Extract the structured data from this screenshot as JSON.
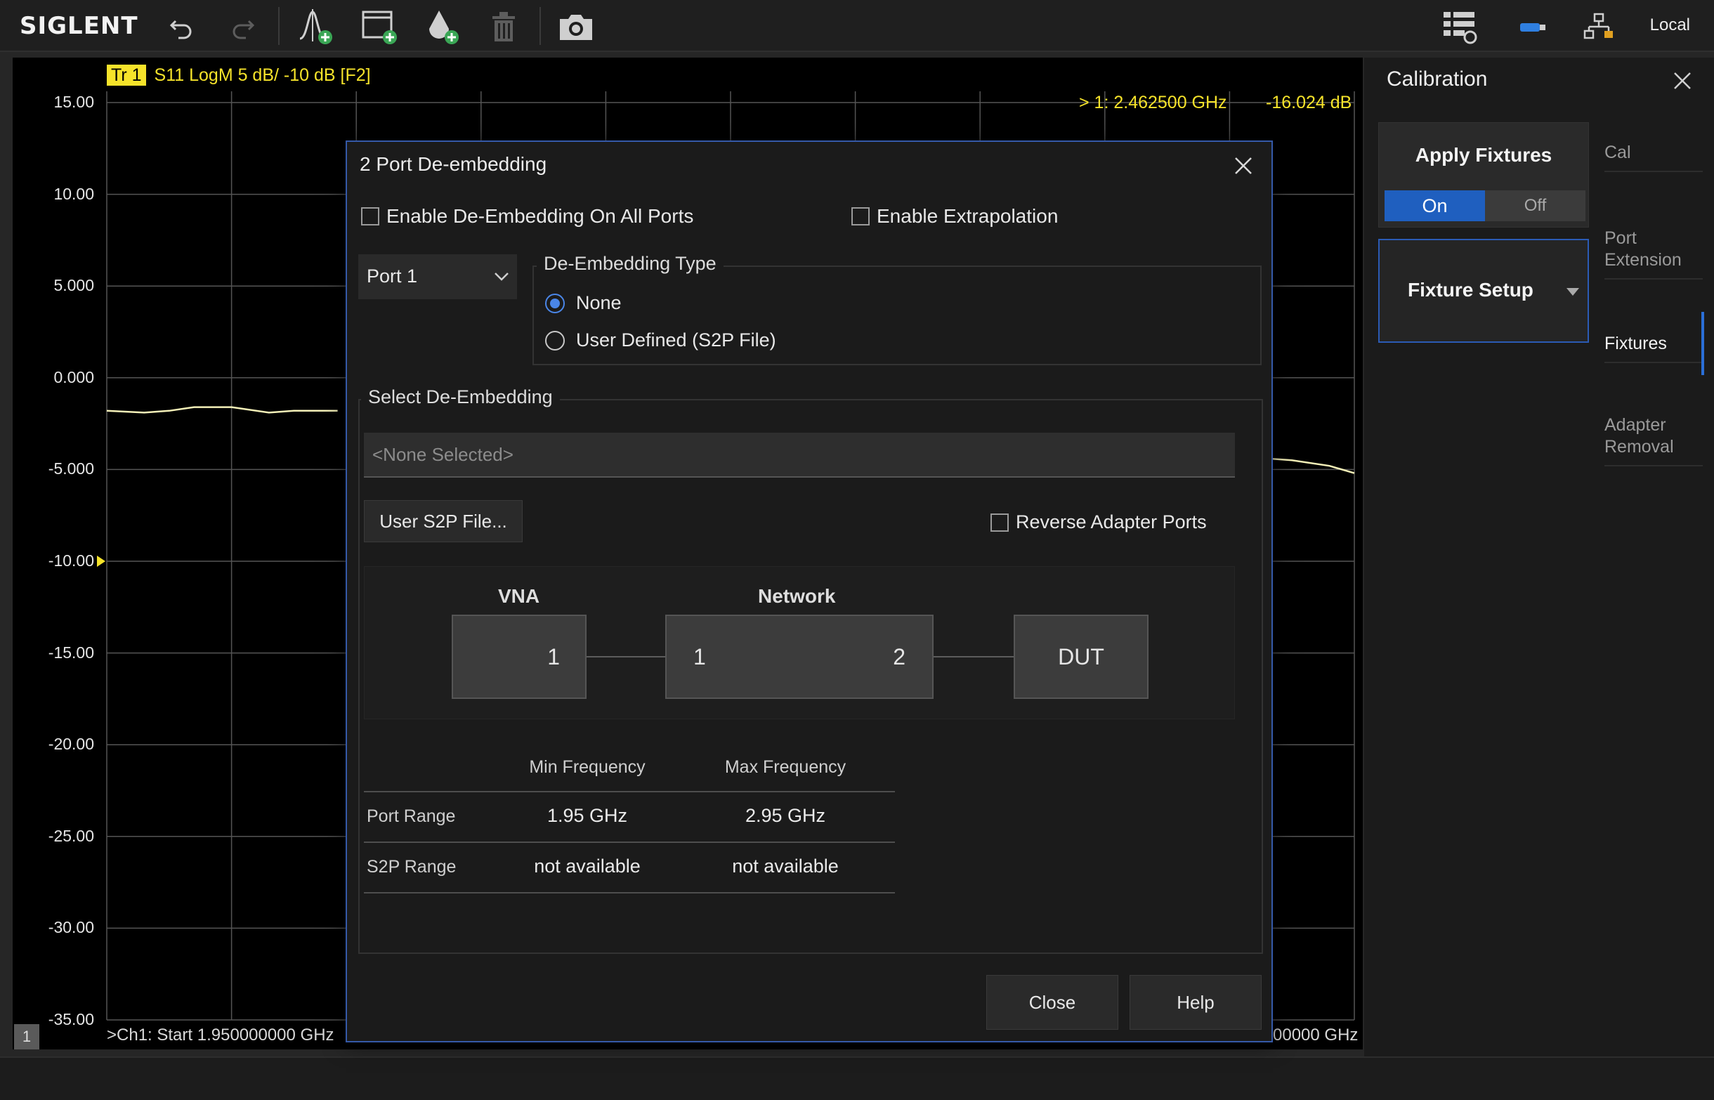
{
  "toolbar": {
    "logo": "SIGLENT",
    "status": "Local"
  },
  "trace": {
    "badge": "Tr 1",
    "label": "S11  LogM 5 dB/ -10 dB [F2]"
  },
  "marker": {
    "label": "> 1:  2.462500 GHz",
    "value": "-16.024 dB"
  },
  "chart_data": {
    "type": "line",
    "title": "",
    "xlabel": "",
    "ylabel": "",
    "y_ticks": [
      "15.00",
      "10.00",
      "5.000",
      "0.000",
      "-5.000",
      "-10.00",
      "-15.00",
      "-20.00",
      "-25.00",
      "-30.00",
      "-35.00"
    ],
    "ylim": [
      -35,
      15
    ],
    "xlim": [
      1.95,
      2.95
    ],
    "reference_level": -10,
    "series": [
      {
        "x": [
          1.95,
          1.98,
          2.0,
          2.02,
          2.05,
          2.08,
          2.1,
          2.135,
          2.8,
          2.83,
          2.86,
          2.9,
          2.93,
          2.95
        ],
        "y": [
          -1.8,
          -1.9,
          -1.8,
          -1.6,
          -1.6,
          -1.9,
          -1.8,
          -1.8,
          -4.0,
          -4.1,
          -4.3,
          -4.5,
          -4.8,
          -5.2
        ]
      }
    ],
    "grid": true,
    "start_label": ">Ch1: Start 1.950000000 GHz",
    "stop_label": "00000 GHz",
    "channel": "1"
  },
  "calibration": {
    "title": "Calibration",
    "apply_fixtures": "Apply Fixtures",
    "toggle_on": "On",
    "toggle_off": "Off",
    "fixture_setup": "Fixture Setup",
    "tabs": [
      "Cal",
      "Port Extension",
      "Fixtures",
      "Adapter Removal"
    ]
  },
  "dialog": {
    "title": "2 Port De-embedding",
    "enable_all_ports": "Enable De-Embedding On All Ports",
    "enable_extrapolation": "Enable Extrapolation",
    "port_select": "Port 1",
    "type_legend": "De-Embedding Type",
    "radio_none": "None",
    "radio_user": "User Defined (S2P File)",
    "select_legend": "Select De-Embedding",
    "none_selected": "<None Selected>",
    "user_file_button": "User S2P File...",
    "reverse_ports": "Reverse Adapter Ports",
    "diagram": {
      "vna_label": "VNA",
      "network_label": "Network",
      "vna_port": "1",
      "net_port1": "1",
      "net_port2": "2",
      "dut": "DUT"
    },
    "table": {
      "min_header": "Min Frequency",
      "max_header": "Max Frequency",
      "rows": [
        {
          "label": "Port Range",
          "min": "1.95 GHz",
          "max": "2.95 GHz"
        },
        {
          "label": "S2P Range",
          "min": "not available",
          "max": "not available"
        }
      ]
    },
    "close_button": "Close",
    "help_button": "Help"
  }
}
